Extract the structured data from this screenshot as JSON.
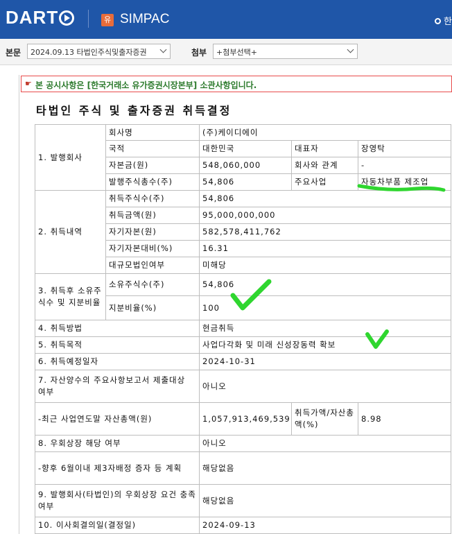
{
  "header": {
    "logo_text": "DART",
    "company_badge": "유",
    "company_name": "SIMPAC",
    "right_text": "한"
  },
  "selectors": {
    "main_label": "본문",
    "main_value": "2024.09.13  타법인주식및출자증권",
    "attach_label": "첨부",
    "attach_value": "+첨부선택+"
  },
  "notice": "본 공시사항은 [한국거래소 유가증권시장본부] 소관사항입니다.",
  "doc_title": "타법인 주식 및 출자증권 취득결정",
  "table": {
    "s1": "1. 발행회사",
    "company_label": "회사명",
    "company_value": "(주)케이디에이",
    "country_label": "국적",
    "country_value": "대한민국",
    "ceo_label": "대표자",
    "ceo_value": "장영탁",
    "capital_label": "자본금(원)",
    "capital_value": "548,060,000",
    "relation_label": "회사와 관계",
    "relation_value": "-",
    "shares_total_label": "발행주식총수(주)",
    "shares_total_value": "54,806",
    "business_label": "주요사업",
    "business_value": "자동차부품 제조업",
    "s2": "2. 취득내역",
    "acq_shares_label": "취득주식수(주)",
    "acq_shares_value": "54,806",
    "acq_amount_label": "취득금액(원)",
    "acq_amount_value": "95,000,000,000",
    "equity_label": "자기자본(원)",
    "equity_value": "582,578,411,762",
    "ratio_label": "자기자본대비(%)",
    "ratio_value": "16.31",
    "large_corp_label": "대규모법인여부",
    "large_corp_value": "미해당",
    "s3": "3. 취득후 소유주식수 및 지분비율",
    "owned_label": "소유주식수(주)",
    "owned_value": "54,806",
    "stake_label": "지분비율(%)",
    "stake_value": "100",
    "s4_label": "4. 취득방법",
    "s4_value": "현금취득",
    "s5_label": "5. 취득목적",
    "s5_value": "사업다각화 및 미래 신성장동력 확보",
    "s6_label": "6. 취득예정일자",
    "s6_value": "2024-10-31",
    "s7_label": "7. 자산양수의 주요사항보고서 제출대상 여부",
    "s7_value": "아니오",
    "assets_label": "-최근 사업연도말 자산총액(원)",
    "assets_value": "1,057,913,469,539",
    "acq_to_assets_label": "취득가액/자산총액(%)",
    "acq_to_assets_value": "8.98",
    "s8_label": "8. 우회상장 해당 여부",
    "s8_value": "아니오",
    "third_party_label": "-향후 6월이내 제3자배정 증자 등 계획",
    "third_party_value": "해당없음",
    "s9_label": "9. 발행회사(타법인)의 우회상장 요건 충족여부",
    "s9_value": "해당없음",
    "s10_label": "10. 이사회결의일(결정일)",
    "s10_value": "2024-09-13"
  },
  "colors": {
    "header_bg": "#1f56a8",
    "notice_border": "#e84a4a",
    "notice_text": "#2c7a2c",
    "annotation": "#2fd62f"
  }
}
